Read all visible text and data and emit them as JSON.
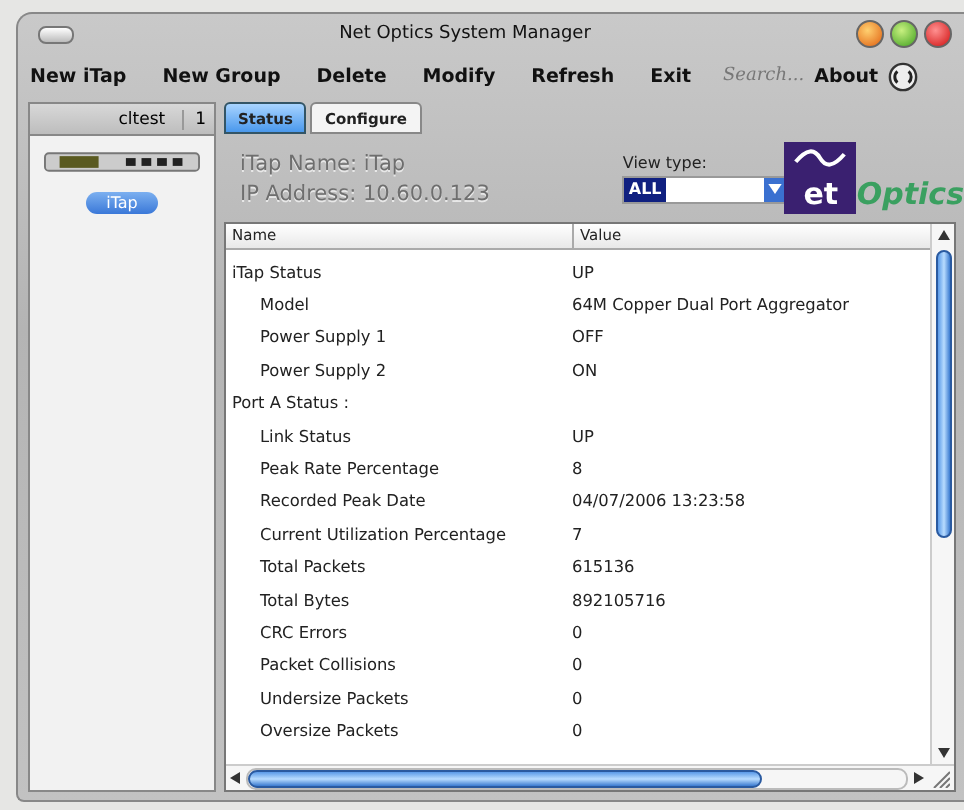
{
  "window": {
    "title": "Net Optics System Manager"
  },
  "toolbar": [
    "New iTap",
    "New Group",
    "Delete",
    "Modify",
    "Refresh",
    "Exit"
  ],
  "search": {
    "placeholder": "Search..."
  },
  "about": "About",
  "sidebar": {
    "group": "cltest",
    "count": "1",
    "device_button": "iTap"
  },
  "tabs": [
    {
      "label": "Status",
      "selected": true
    },
    {
      "label": "Configure",
      "selected": false
    }
  ],
  "info": {
    "name": "iTap Name: iTap",
    "ip": "IP Address: 10.60.0.123",
    "view_type_label": "View type:",
    "view_type_value": "ALL"
  },
  "logo": {
    "mark": "et",
    "word": "Optics"
  },
  "table": {
    "columns": [
      "Name",
      "Value"
    ],
    "rows": [
      {
        "name": "iTap Status",
        "value": "UP",
        "children": [
          {
            "name": "Model",
            "value": "64M Copper Dual Port Aggregator"
          },
          {
            "name": "Power Supply 1",
            "value": "OFF"
          },
          {
            "name": "Power Supply 2",
            "value": "ON"
          }
        ]
      },
      {
        "name": "Port A Status :",
        "children": [
          {
            "name": "Link Status",
            "value": "UP"
          },
          {
            "name": "Peak Rate Percentage",
            "value": "8"
          },
          {
            "name": "Recorded Peak Date",
            "value": "04/07/2006 13:23:58"
          },
          {
            "name": "Current Utilization Percentage",
            "value": "7"
          },
          {
            "name": "Total Packets",
            "value": "615136"
          },
          {
            "name": "Total Bytes",
            "value": "892105716"
          },
          {
            "name": "CRC Errors",
            "value": "0"
          },
          {
            "name": "Packet Collisions",
            "value": "0"
          },
          {
            "name": "Undersize Packets",
            "value": "0"
          },
          {
            "name": "Oversize Packets",
            "value": "0"
          }
        ]
      }
    ]
  }
}
